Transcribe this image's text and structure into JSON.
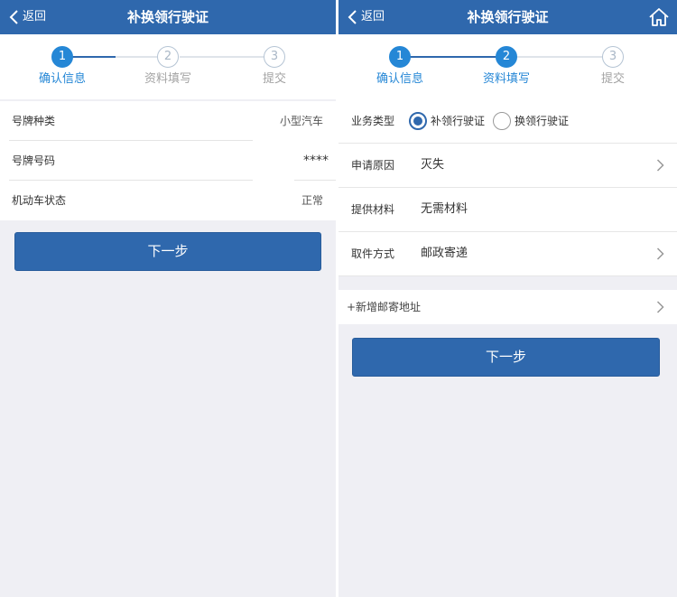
{
  "colors": {
    "header": "#2f68ad",
    "step_active": "#2587d6",
    "step_inactive": "#a9b7c6",
    "button": "#2f68ad"
  },
  "left": {
    "header": {
      "back_label": "返回",
      "title": "补换领行驶证"
    },
    "steps": [
      {
        "number": "1",
        "label": "确认信息",
        "state": "active"
      },
      {
        "number": "2",
        "label": "资料填写",
        "state": "inactive"
      },
      {
        "number": "3",
        "label": "提交",
        "state": "inactive"
      }
    ],
    "rows": [
      {
        "label": "号牌种类",
        "value": "小型汽车"
      },
      {
        "label": "号牌号码",
        "value": "****"
      },
      {
        "label": "机动车状态",
        "value": "正常"
      }
    ],
    "next_label": "下一步"
  },
  "right": {
    "header": {
      "back_label": "返回",
      "title": "补换领行驶证",
      "home_icon": "home-icon"
    },
    "steps": [
      {
        "number": "1",
        "label": "确认信息",
        "state": "active"
      },
      {
        "number": "2",
        "label": "资料填写",
        "state": "active"
      },
      {
        "number": "3",
        "label": "提交",
        "state": "inactive"
      }
    ],
    "business_type": {
      "label": "业务类型",
      "options": [
        {
          "label": "补领行驶证",
          "checked": true
        },
        {
          "label": "换领行驶证",
          "checked": false
        }
      ]
    },
    "rows": [
      {
        "label": "申请原因",
        "value": "灭失"
      },
      {
        "label": "提供材料",
        "value": "无需材料"
      },
      {
        "label": "取件方式",
        "value": "邮政寄递"
      }
    ],
    "address_label": "+新增邮寄地址",
    "next_label": "下一步"
  }
}
